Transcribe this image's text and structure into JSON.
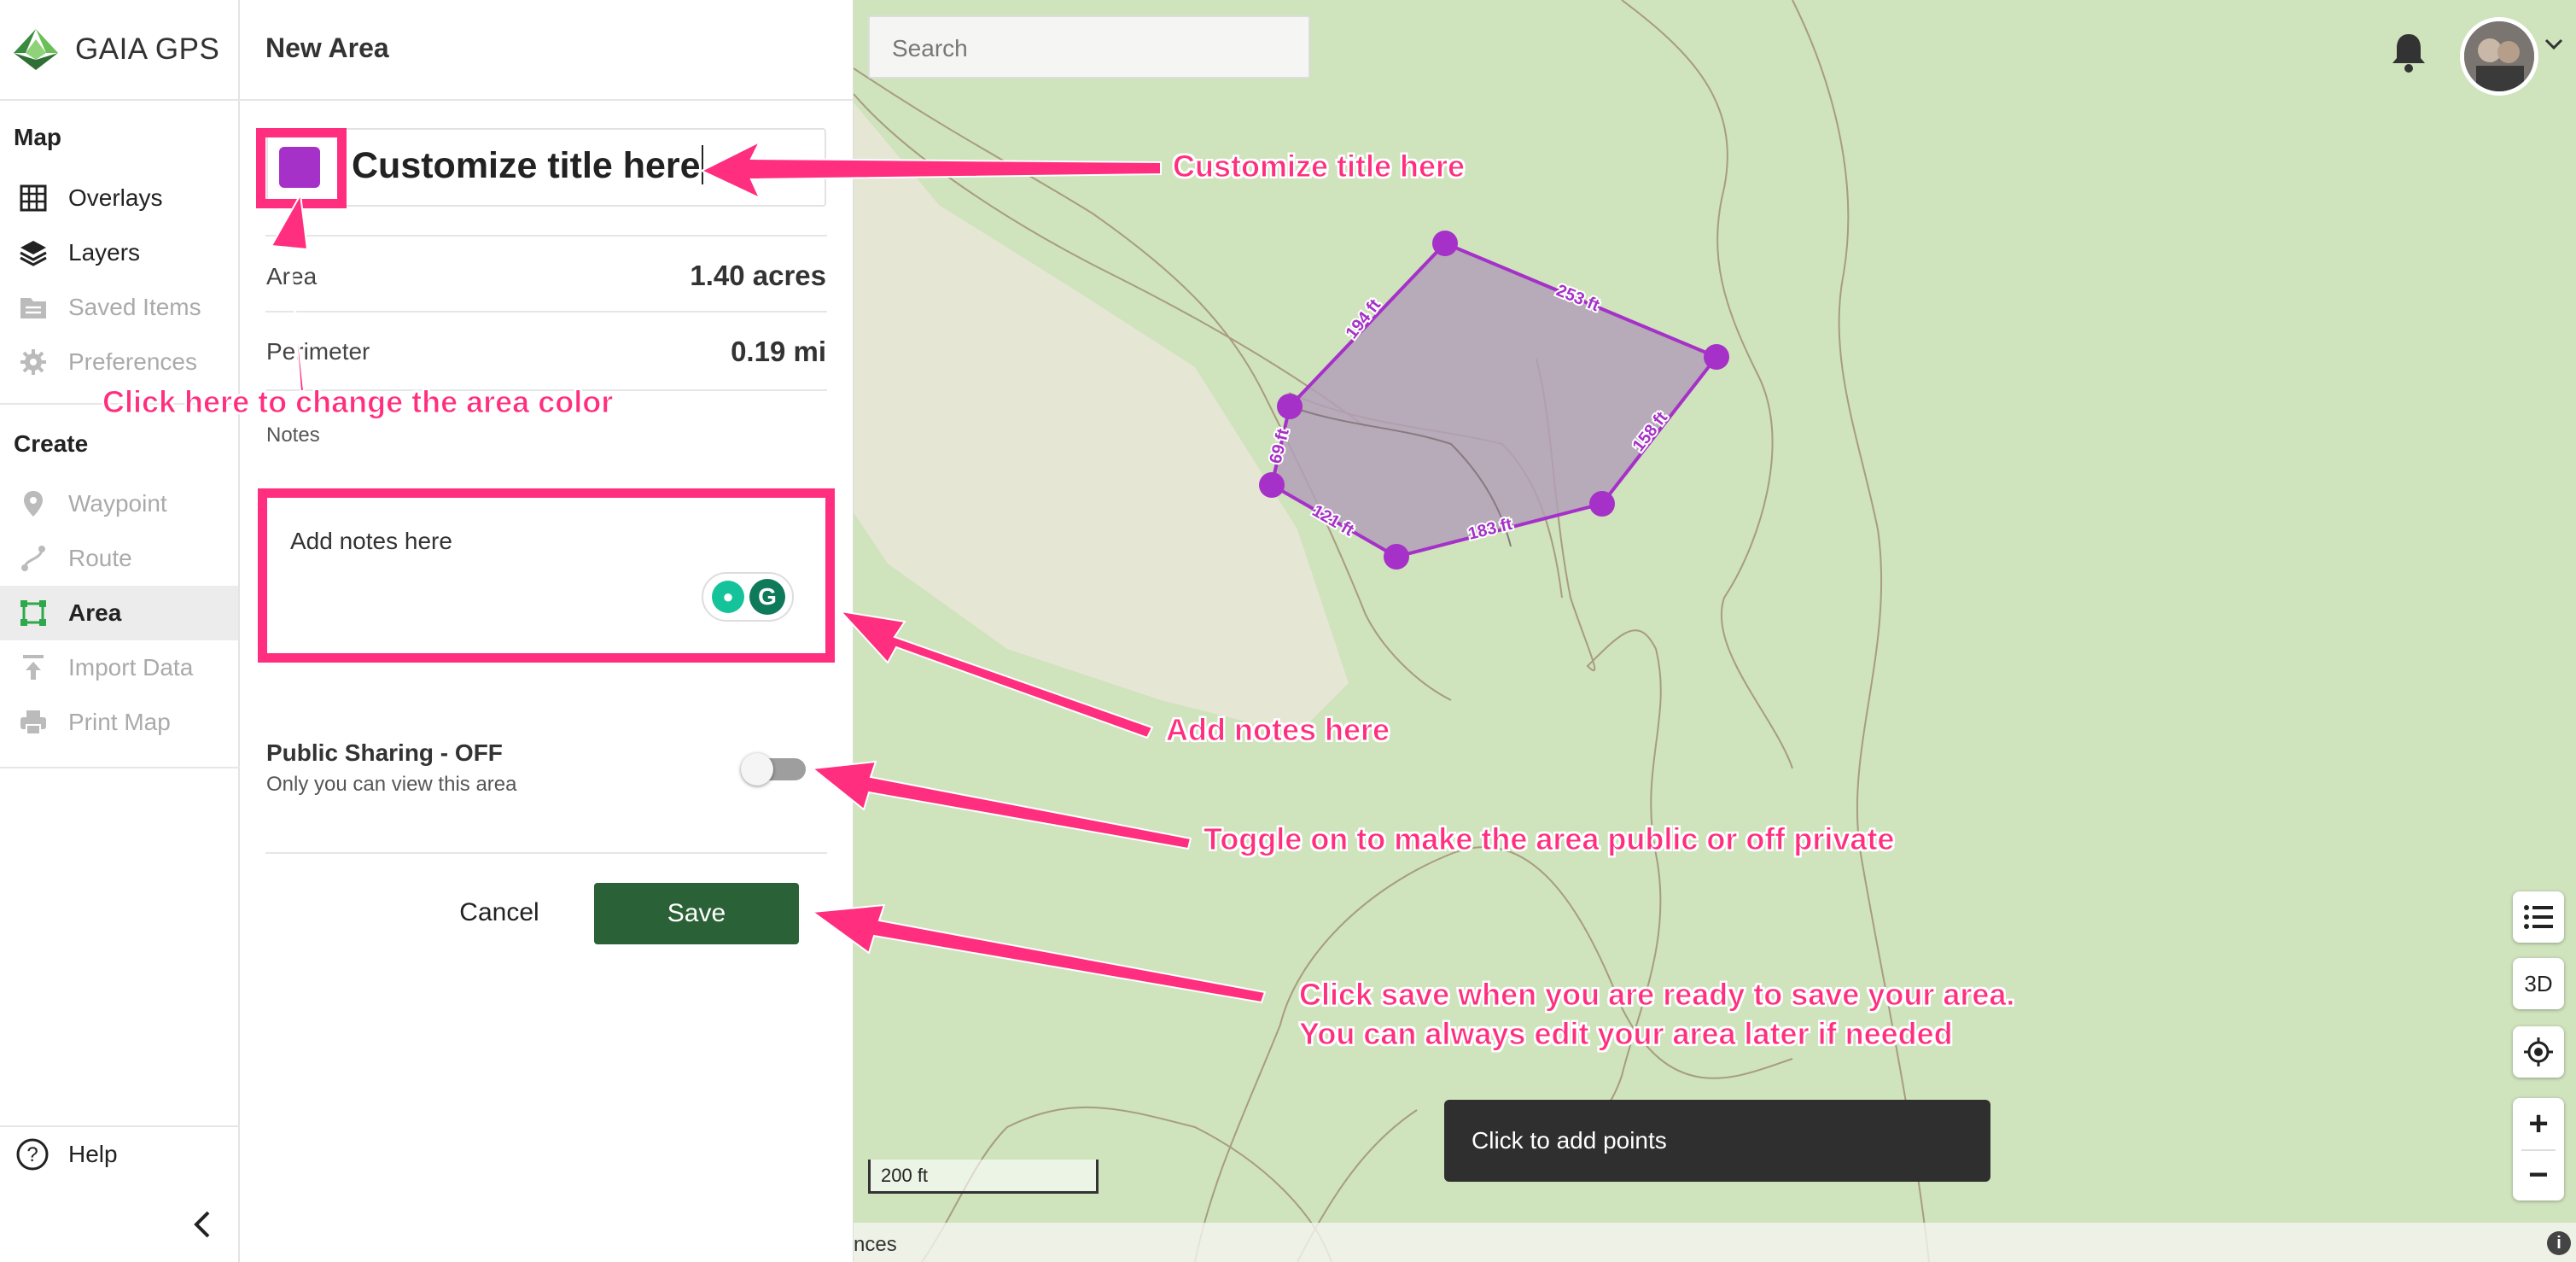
{
  "app": {
    "name": "GAIA GPS"
  },
  "sidebar": {
    "map_heading": "Map",
    "map_items": [
      {
        "label": "Overlays",
        "icon": "grid-icon",
        "dim": false
      },
      {
        "label": "Layers",
        "icon": "layers-icon",
        "dim": false
      },
      {
        "label": "Saved Items",
        "icon": "folder-icon",
        "dim": true
      },
      {
        "label": "Preferences",
        "icon": "gear-icon",
        "dim": true
      }
    ],
    "create_heading": "Create",
    "create_items": [
      {
        "label": "Waypoint",
        "icon": "pin-icon",
        "dim": true
      },
      {
        "label": "Route",
        "icon": "route-icon",
        "dim": true
      },
      {
        "label": "Area",
        "icon": "area-icon",
        "dim": false,
        "active": true
      },
      {
        "label": "Import Data",
        "icon": "upload-icon",
        "dim": true
      },
      {
        "label": "Print Map",
        "icon": "printer-icon",
        "dim": true
      }
    ],
    "help_label": "Help"
  },
  "panel": {
    "title": "New Area",
    "name_value": "Customize title here",
    "area_color": "#a631c8",
    "area_label": "Area",
    "area_value": "1.40 acres",
    "perimeter_label": "Perimeter",
    "perimeter_value": "0.19 mi",
    "notes_label": "Notes",
    "notes_placeholder": "Add notes here",
    "sharing_title": "Public Sharing - OFF",
    "sharing_sub": "Only you can view this area",
    "sharing_on": false,
    "cancel_label": "Cancel",
    "save_label": "Save"
  },
  "map": {
    "search_placeholder": "Search",
    "toast": "Click to add points",
    "scale_label": "200 ft",
    "attribution_fragment": "nces",
    "btn_3d": "3D",
    "zoom_in": "+",
    "zoom_out": "−",
    "info": "i",
    "segment_labels": [
      "194 ft",
      "253 ft",
      "158 ft",
      "183 ft",
      "121 ft",
      "69 ft"
    ],
    "polygon_color": "#a631c8"
  },
  "annotations": {
    "title": "Customize title here",
    "color": "Click here to change the area color",
    "notes": "Add notes here",
    "toggle": "Toggle on to make the area public or off private",
    "save_line1": "Click save when you are ready to save your area.",
    "save_line2": "You can always edit your area later if needed"
  },
  "colors": {
    "accent_pink": "#ff2e7e",
    "save_green": "#2b6136",
    "map_green": "#cfe3bd",
    "logo_green": "#3a8a3f"
  }
}
